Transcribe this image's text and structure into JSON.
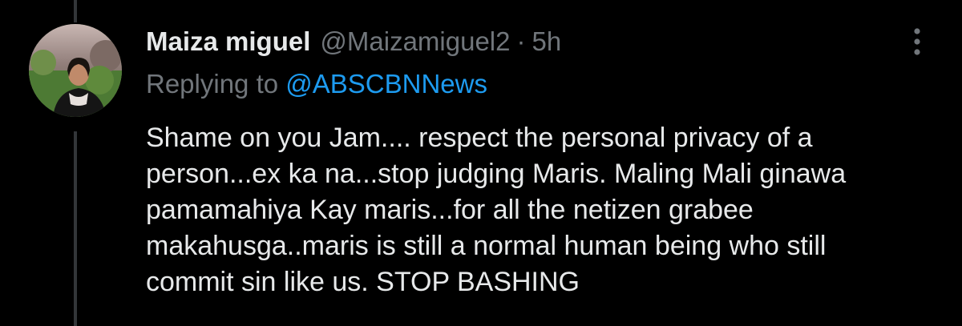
{
  "tweet": {
    "display_name": "Maiza miguel",
    "handle": "@Maizamiguel2",
    "separator": "·",
    "timestamp": "5h",
    "replying_prefix": "Replying to ",
    "replying_to": "@ABSCBNNews",
    "text_lines": [
      "Shame on you Jam.... respect the personal privacy of a",
      "person...ex ka na...stop judging Maris. Maling Mali ginawa",
      "pamamahiya Kay maris...for all the netizen grabee",
      "makahusga..maris is still a normal human being who still",
      "commit sin like us. STOP BASHING"
    ]
  },
  "icons": {
    "more": "more-vertical-icon",
    "avatar": "profile-photo"
  },
  "colors": {
    "background": "#000000",
    "primary_text": "#e7e9ea",
    "secondary_text": "#71767b",
    "link": "#1d9bf0",
    "thread_line": "#333639"
  }
}
